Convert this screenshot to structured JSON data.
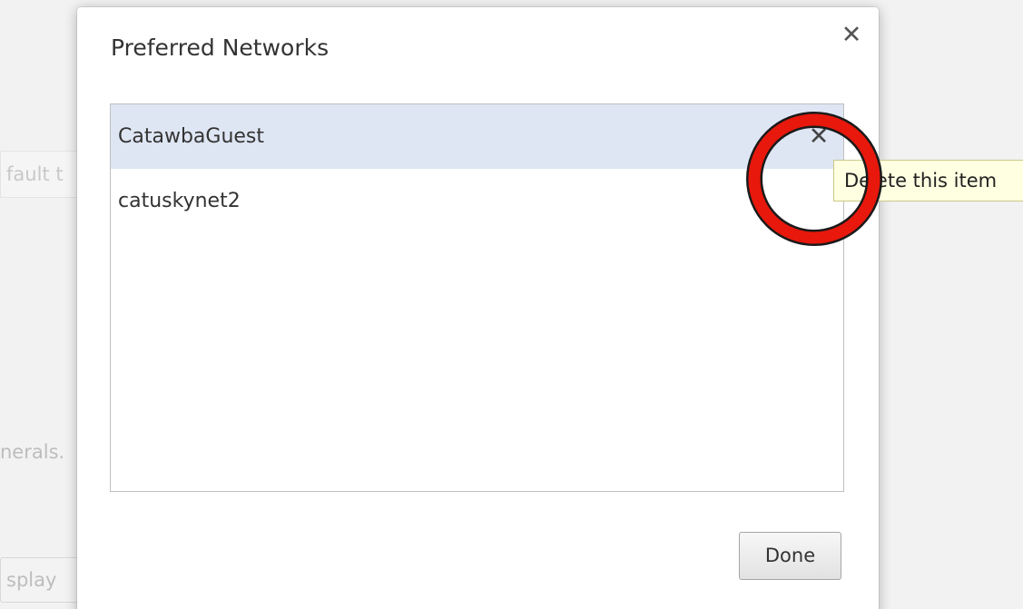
{
  "background": {
    "field_text": "fault t",
    "text_fragment": "nerals.",
    "button_text": "splay"
  },
  "dialog": {
    "title": "Preferred Networks",
    "close_glyph": "✕",
    "networks": [
      {
        "name": "CatawbaGuest",
        "selected": true
      },
      {
        "name": "catuskynet2",
        "selected": false
      }
    ],
    "delete_glyph": "✕",
    "done_label": "Done"
  },
  "tooltip": {
    "text": "Delete this item"
  },
  "annotation": {
    "type": "circle-highlight",
    "color": "#e8180c"
  },
  "colors": {
    "selected_row": "#dfe6f3",
    "tooltip_bg": "#ffffe1",
    "annotation": "#e8180c"
  }
}
